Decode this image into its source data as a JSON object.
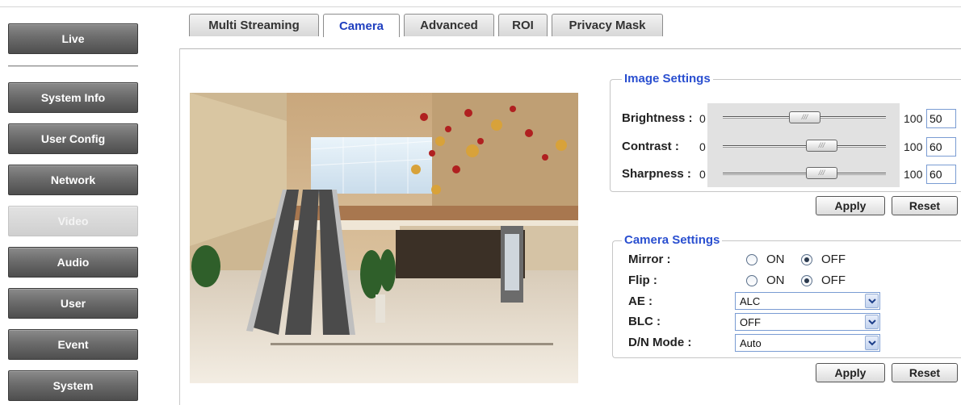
{
  "sidebar": {
    "items": [
      {
        "label": "Live",
        "active": false
      },
      {
        "label": "System Info",
        "active": false
      },
      {
        "label": "User Config",
        "active": false
      },
      {
        "label": "Network",
        "active": false
      },
      {
        "label": "Video",
        "active": true
      },
      {
        "label": "Audio",
        "active": false
      },
      {
        "label": "User",
        "active": false
      },
      {
        "label": "Event",
        "active": false
      },
      {
        "label": "System",
        "active": false
      }
    ]
  },
  "tabs": [
    {
      "label": "Multi Streaming",
      "active": false
    },
    {
      "label": "Camera",
      "active": true
    },
    {
      "label": "Advanced",
      "active": false
    },
    {
      "label": "ROI",
      "active": false
    },
    {
      "label": "Privacy Mask",
      "active": false
    }
  ],
  "image_settings": {
    "legend": "Image Settings",
    "sliders": [
      {
        "label": "Brightness :",
        "min": "0",
        "max": "100",
        "value": "50"
      },
      {
        "label": "Contrast :",
        "min": "0",
        "max": "100",
        "value": "60"
      },
      {
        "label": "Sharpness :",
        "min": "0",
        "max": "100",
        "value": "60"
      }
    ],
    "apply_label": "Apply",
    "reset_label": "Reset"
  },
  "camera_settings": {
    "legend": "Camera Settings",
    "mirror": {
      "label": "Mirror :",
      "on_label": "ON",
      "off_label": "OFF",
      "selected": "OFF"
    },
    "flip": {
      "label": "Flip :",
      "on_label": "ON",
      "off_label": "OFF",
      "selected": "OFF"
    },
    "ae": {
      "label": "AE :",
      "value": "ALC"
    },
    "blc": {
      "label": "BLC :",
      "value": "OFF"
    },
    "dn_mode": {
      "label": "D/N Mode :",
      "value": "Auto"
    },
    "apply_label": "Apply",
    "reset_label": "Reset"
  },
  "colors": {
    "accent": "#2a4fd0",
    "tab_active": "#1f3fbf",
    "nav": "#6c6c6c"
  }
}
